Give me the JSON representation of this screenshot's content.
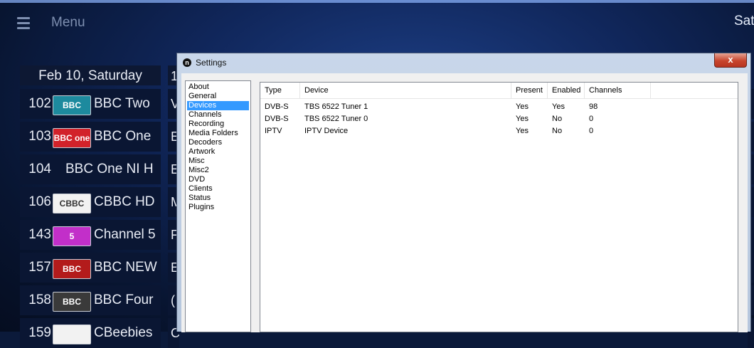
{
  "header": {
    "menu_label": "Menu",
    "right_label": "Sat"
  },
  "guide": {
    "date": "Feb 10, Saturday",
    "next_col_header": "1",
    "channels": [
      {
        "number": "102",
        "name": "BBC Two",
        "logo_text": "BBC TWO",
        "logo_color": "#1d8a9e",
        "prog": "V"
      },
      {
        "number": "103",
        "name": "BBC One",
        "logo_text": "BBC one",
        "logo_color": "#d2222a",
        "prog": "E"
      },
      {
        "number": "104",
        "name": "BBC One NI H",
        "logo_text": "",
        "logo_color": "",
        "prog": "E"
      },
      {
        "number": "106",
        "name": "CBBC HD",
        "logo_text": "CBBC",
        "logo_color": "#f2f2f2",
        "prog": "M"
      },
      {
        "number": "143",
        "name": "Channel 5",
        "logo_text": "5",
        "logo_color": "#c22fc9",
        "prog": "F"
      },
      {
        "number": "157",
        "name": "BBC NEW",
        "logo_text": "BBC NEWS",
        "logo_color": "#b31b1b",
        "prog": "E"
      },
      {
        "number": "158",
        "name": "BBC Four",
        "logo_text": "BBC FOUR",
        "logo_color": "#3a3a3a",
        "prog": "("
      },
      {
        "number": "159",
        "name": "CBeebies",
        "logo_text": "",
        "logo_color": "#f2f2f2",
        "prog": "C"
      }
    ]
  },
  "settings": {
    "title": "Settings",
    "title_icon": "n",
    "close_label": "x",
    "nav_items": [
      "About",
      "General",
      "Devices",
      "Channels",
      "Recording",
      "Media Folders",
      "Decoders",
      "Artwork",
      "Misc",
      "Misc2",
      "DVD",
      "Clients",
      "Status",
      "Plugins"
    ],
    "selected_nav": "Devices",
    "columns": [
      "Type",
      "Device",
      "Present",
      "Enabled",
      "Channels"
    ],
    "rows": [
      [
        "DVB-S",
        "TBS 6522 Tuner 1",
        "Yes",
        "Yes",
        "98"
      ],
      [
        "DVB-S",
        "TBS 6522 Tuner 0",
        "Yes",
        "No",
        "0"
      ],
      [
        "IPTV",
        "IPTV Device",
        "Yes",
        "No",
        "0"
      ]
    ]
  },
  "colors": {
    "selection": "#3399ff",
    "close_button": "#c8452d",
    "background": "#10265a"
  }
}
